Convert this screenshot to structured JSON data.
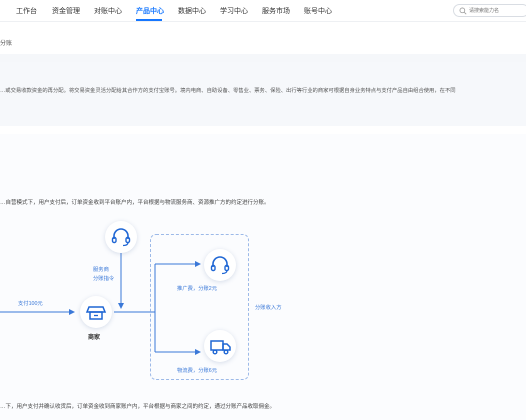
{
  "nav": {
    "items": [
      {
        "label": "工作台",
        "active": false
      },
      {
        "label": "资金管理",
        "active": false
      },
      {
        "label": "对账中心",
        "active": false
      },
      {
        "label": "产品中心",
        "active": true
      },
      {
        "label": "数据中心",
        "active": false
      },
      {
        "label": "学习中心",
        "active": false
      },
      {
        "label": "服务市场",
        "active": false
      },
      {
        "label": "账号中心",
        "active": false
      }
    ],
    "search_placeholder": "请搜索能力名"
  },
  "breadcrumb": "分账",
  "intro_text": "…或交易收款资金的再分配。将交易资金灵活分配给其合作方的支付宝账号。境内电商、自助设备、零售业、票务、保险、出行等行业的商家可根据自身业务特点与支付产品自由组合使用，在不同",
  "scenario1_text": "…自营模式下，用户支付后，订单资金收到平台账户内，平台根据与物流服务商、资源推广方的约定进行分账。",
  "scenario2_text": "…下，用户支付并确认收货后，订单资金收到商家账户内，平台根据与商家之间的约定，通过分账产品收取佣金。",
  "diagram": {
    "service_label_1": "服务商",
    "service_label_2": "分账指令",
    "pay_label": "支付100元",
    "merchant_label": "商家",
    "promoter_label": "推广费，分账2元",
    "logistics_label": "物流费，分账6元",
    "receiver_label": "分账收入方"
  },
  "colors": {
    "accent": "#1677ff",
    "line": "#3a78d8"
  }
}
